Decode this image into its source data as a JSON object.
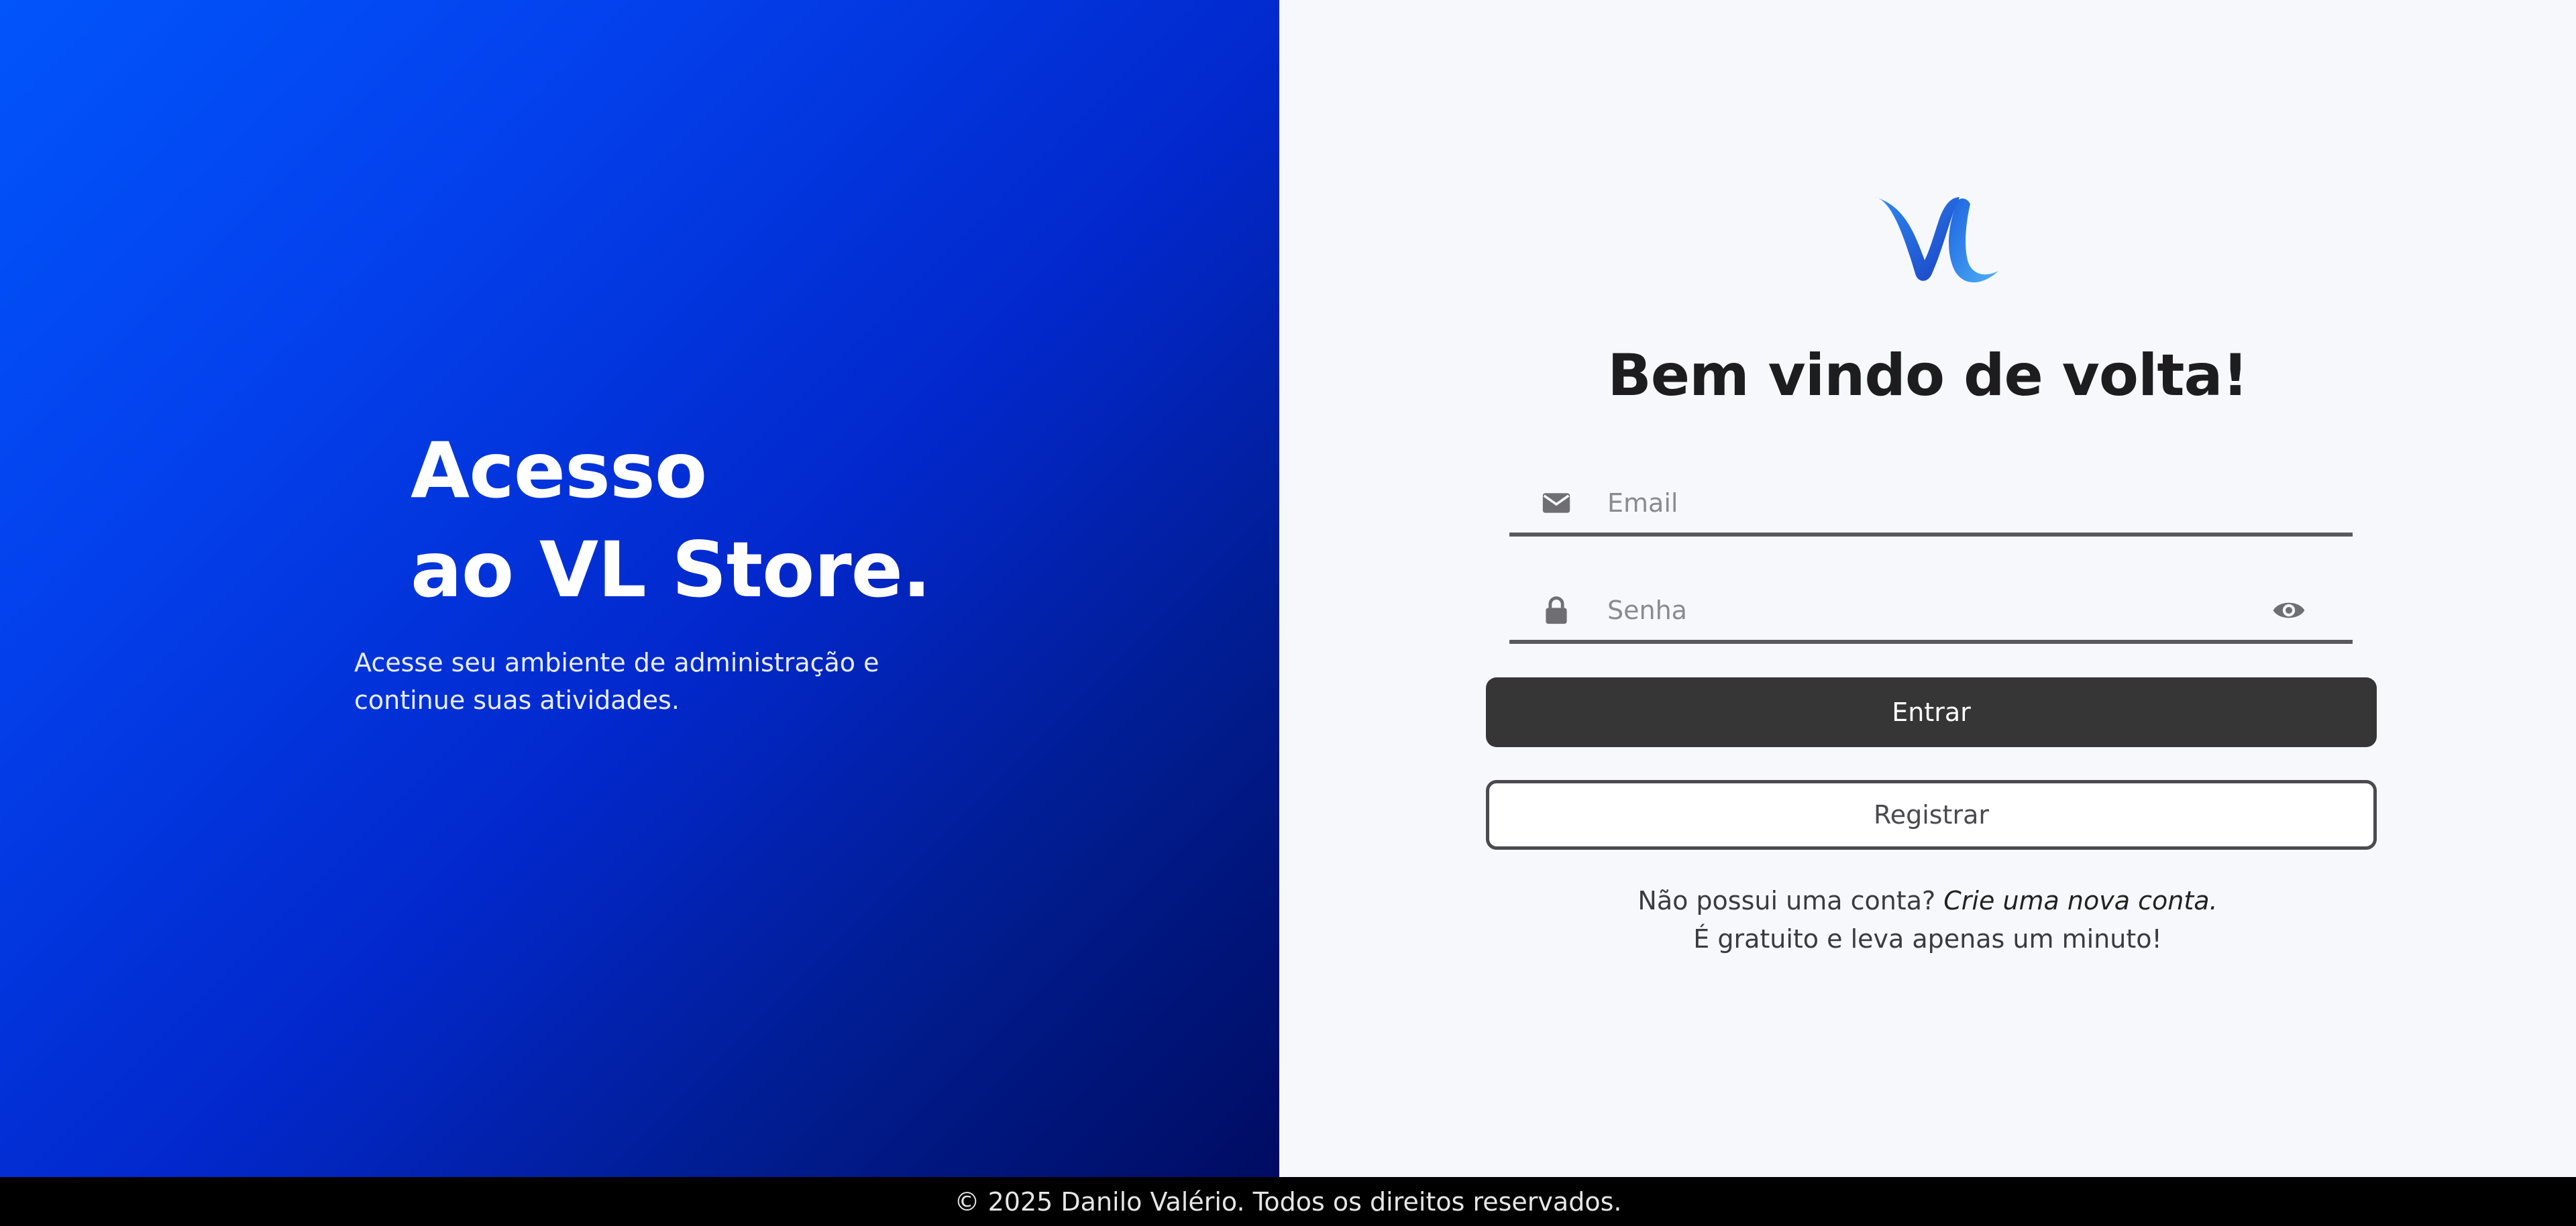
{
  "hero": {
    "title_line1": "Acesso",
    "title_line2": "ao VL Store.",
    "subtitle": "Acesse seu ambiente de administração e continue suas atividades."
  },
  "login": {
    "logo_icon": "vl-logo-icon",
    "welcome": "Bem vindo de volta!",
    "email": {
      "placeholder": "Email",
      "value": "",
      "icon": "envelope-icon"
    },
    "password": {
      "placeholder": "Senha",
      "value": "",
      "icon": "lock-icon",
      "toggle_icon": "eye-icon"
    },
    "submit_label": "Entrar",
    "register_label": "Registrar",
    "signup_prompt": "Não possui uma conta?",
    "signup_link": "Crie uma nova conta.",
    "signup_note": "É gratuito e leva apenas um minuto!"
  },
  "footer": {
    "copyright": "© 2025 Danilo Valério. Todos os direitos reservados."
  },
  "colors": {
    "hero_gradient_start": "#0255fb",
    "hero_gradient_end": "#000c62",
    "panel_bg": "#f6f8fb",
    "primary_button": "#373637",
    "footer_bg": "#000000"
  }
}
